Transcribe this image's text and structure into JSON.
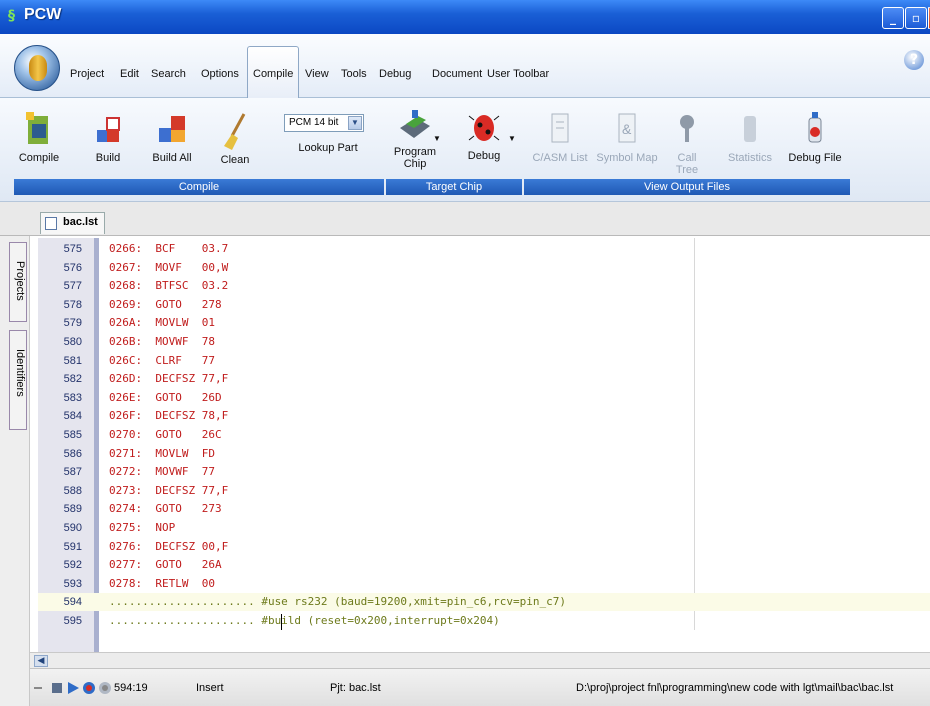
{
  "window": {
    "title": "PCW"
  },
  "menu": {
    "items": [
      "Project",
      "Edit",
      "Search",
      "Options",
      "Compile",
      "View",
      "Tools",
      "Debug",
      "Document",
      "User Toolbar"
    ],
    "active": "Compile"
  },
  "ribbon": {
    "compile_group": {
      "label": "Compile",
      "buttons": [
        {
          "label": "Compile",
          "icon": "compile-icon"
        },
        {
          "label": "Build",
          "icon": "build-icon"
        },
        {
          "label": "Build All",
          "icon": "build-all-icon"
        },
        {
          "label": "Clean",
          "icon": "broom-icon"
        }
      ],
      "part_select": {
        "value": "PCM 14 bit"
      },
      "lookup_label": "Lookup Part"
    },
    "target_group": {
      "label": "Target Chip",
      "program_label_1": "Program",
      "program_label_2": "Chip",
      "debug_label": "Debug"
    },
    "output_group": {
      "label": "View Output Files",
      "buttons": [
        "C/ASM List",
        "Symbol Map",
        "Call Tree",
        "Statistics",
        "Debug File"
      ]
    }
  },
  "document": {
    "tab": "bac.lst"
  },
  "side_tabs": [
    "Projects",
    "Identifiers"
  ],
  "code_lines": [
    {
      "n": "575",
      "text": "0266:  BCF    03.7"
    },
    {
      "n": "576",
      "text": "0267:  MOVF   00,W"
    },
    {
      "n": "577",
      "text": "0268:  BTFSC  03.2"
    },
    {
      "n": "578",
      "text": "0269:  GOTO   278"
    },
    {
      "n": "579",
      "text": "026A:  MOVLW  01"
    },
    {
      "n": "580",
      "text": "026B:  MOVWF  78"
    },
    {
      "n": "581",
      "text": "026C:  CLRF   77"
    },
    {
      "n": "582",
      "text": "026D:  DECFSZ 77,F"
    },
    {
      "n": "583",
      "text": "026E:  GOTO   26D"
    },
    {
      "n": "584",
      "text": "026F:  DECFSZ 78,F"
    },
    {
      "n": "585",
      "text": "0270:  GOTO   26C"
    },
    {
      "n": "586",
      "text": "0271:  MOVLW  FD"
    },
    {
      "n": "587",
      "text": "0272:  MOVWF  77"
    },
    {
      "n": "588",
      "text": "0273:  DECFSZ 77,F"
    },
    {
      "n": "589",
      "text": "0274:  GOTO   273"
    },
    {
      "n": "590",
      "text": "0275:  NOP"
    },
    {
      "n": "591",
      "text": "0276:  DECFSZ 00,F"
    },
    {
      "n": "592",
      "text": "0277:  GOTO   26A"
    },
    {
      "n": "593",
      "text": "0278:  RETLW  00"
    },
    {
      "n": "594",
      "text": "...................... #use rs232 (baud=19200,xmit=pin_c6,rcv=pin_c7)"
    },
    {
      "n": "595",
      "text": "...................... #build (reset=0x200,interrupt=0x204)"
    }
  ],
  "status": {
    "position": "594:19",
    "mode": "Insert",
    "project": "Pjt: bac.lst",
    "path": "D:\\proj\\project fnl\\programming\\new code with lgt\\mail\\bac\\bac.lst"
  }
}
